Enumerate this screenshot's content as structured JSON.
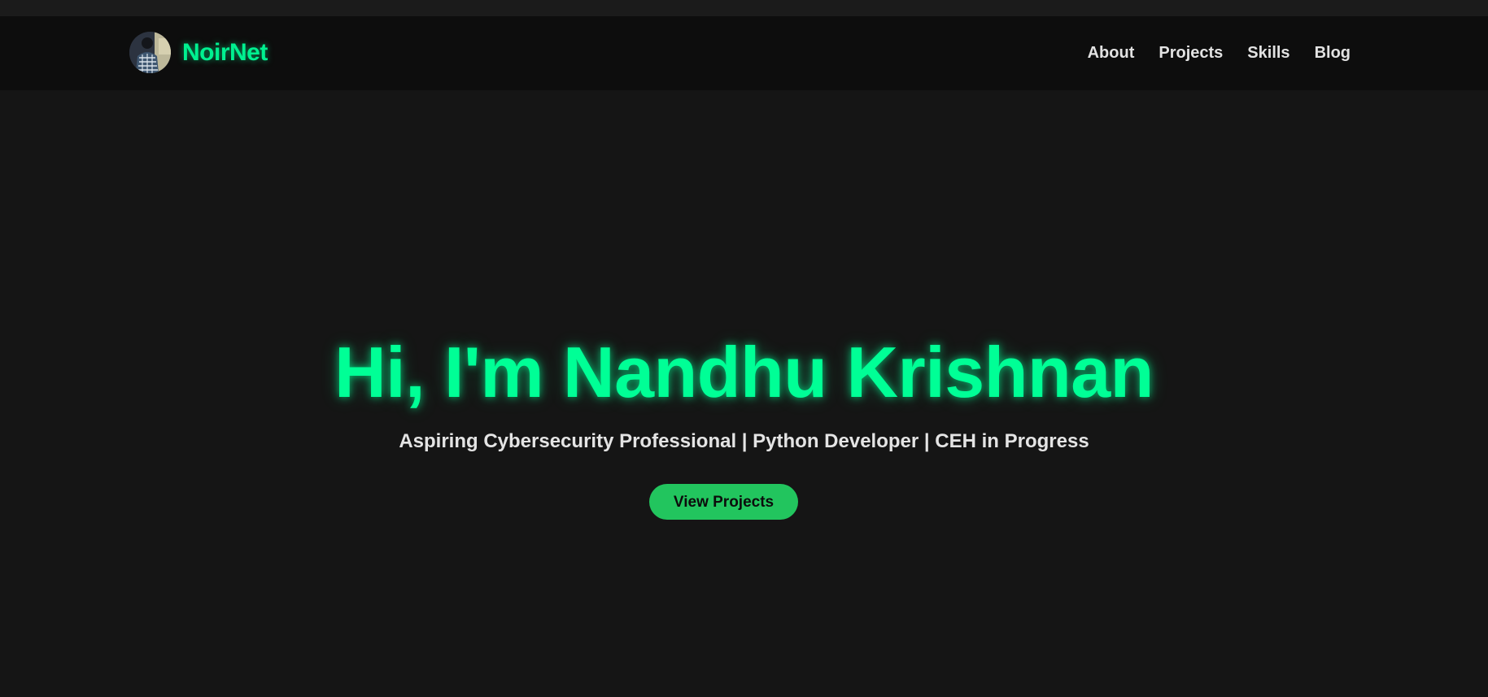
{
  "header": {
    "brand_name": "NoirNet",
    "nav": [
      {
        "label": "About"
      },
      {
        "label": "Projects"
      },
      {
        "label": "Skills"
      },
      {
        "label": "Blog"
      }
    ]
  },
  "hero": {
    "title": "Hi, I'm Nandhu Krishnan",
    "subtitle": "Aspiring Cybersecurity Professional | Python Developer | CEH in Progress",
    "cta_label": "View Projects"
  },
  "colors": {
    "background": "#151515",
    "navbar_background": "#0d0d0d",
    "accent_green": "#00ff96",
    "button_green": "#22c55e",
    "nav_text": "#e2e2e2"
  }
}
